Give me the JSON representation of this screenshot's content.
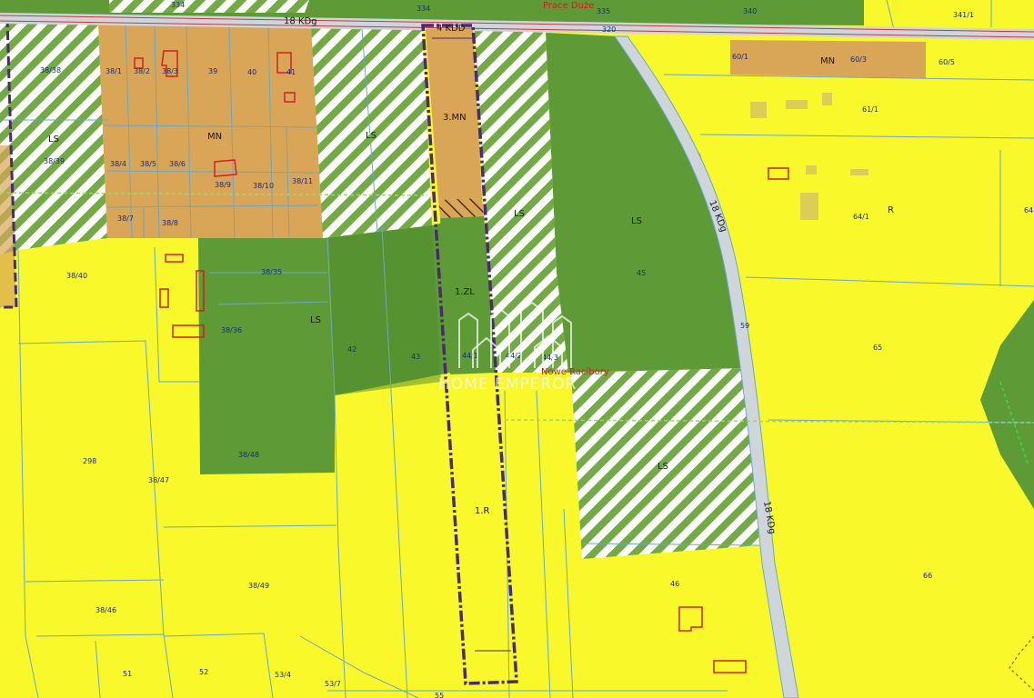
{
  "map": {
    "colors": {
      "agricultural": "#f8f82a",
      "forest": "#5e9a36",
      "forest_dark": "#4f8a2c",
      "residential": "#d8a656",
      "hatch_green": "#73aa45",
      "hatch_white": "#ffffff",
      "boundary_blue": "#6aa8c8",
      "building_red": "#d42020",
      "road_gray": "#cfd6db",
      "road_line": "#c23a3a",
      "subject_outline": "#4a2a70"
    },
    "roads": {
      "top_road": "18 KDg",
      "side_road_upper": "18 KDg",
      "side_road_lower": "18 KDg",
      "access_road": "4 KDD"
    },
    "places": {
      "village_top": "Prace Duże",
      "village_mid": "Nowe Racibory"
    },
    "watermark": {
      "text": "HOME EMPEROR"
    },
    "zones": {
      "ls_left": "LS",
      "mn_block": "MN",
      "ls_hatch_1": "LS",
      "mn_subject": "3.MN",
      "ls_hatch_2": "LS",
      "ls_forest": "LS",
      "mn_topright": "MN",
      "r_right": "R",
      "zl_subject": "1.ZL",
      "ls_forest_2": "LS",
      "r_subject": "1.R",
      "ls_hatch_3": "LS"
    },
    "plots": {
      "p334": "334",
      "p335": "335",
      "p340": "340",
      "p341_1": "341/1",
      "p320": "320",
      "p38_38": "38/38",
      "p38_39": "38/39",
      "p38_1": "38/1",
      "p38_2": "38/2",
      "p38_3": "38/3",
      "p39": "39",
      "p40": "40",
      "p41": "41",
      "p38_4": "38/4",
      "p38_5": "38/5",
      "p38_6": "38/6",
      "p38_9": "38/9",
      "p38_10": "38/10",
      "p38_11": "38/11",
      "p38_7": "38/7",
      "p38_8": "38/8",
      "p60_1": "60/1",
      "p60_3": "60/3",
      "p60_5": "60/5",
      "p61_1": "61/1",
      "p64_1": "64/1",
      "p64": "64",
      "p45": "45",
      "p38_40": "38/40",
      "p38_35": "38/35",
      "p38_36": "38/36",
      "p42": "42",
      "p43": "43",
      "p44_1": "44/1",
      "p44_2": "44/2",
      "p44_3": "44/3",
      "p59": "59",
      "p65": "65",
      "p298": "298",
      "p38_47": "38/47",
      "p38_48": "38/48",
      "p38_49": "38/49",
      "p38_46": "38/46",
      "p46": "46",
      "p66": "66",
      "p51": "51",
      "p52": "52",
      "p53_4": "53/4",
      "p53_7": "53/7",
      "p55": "55"
    }
  }
}
